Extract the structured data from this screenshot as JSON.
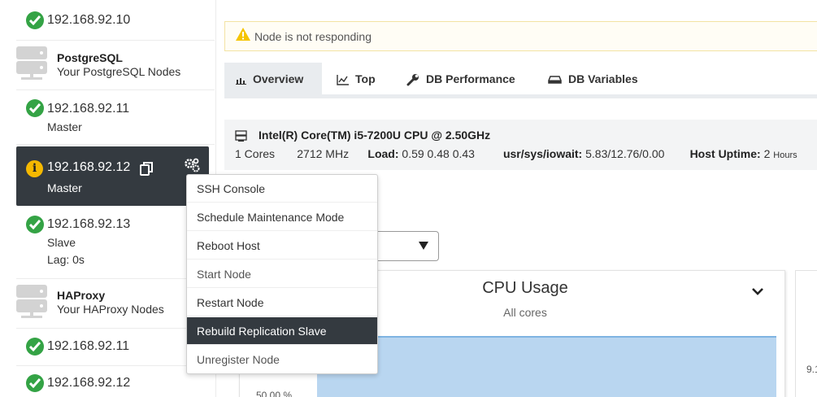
{
  "sidebar": {
    "top_node": {
      "ip": "192.168.92.10"
    },
    "postgres_group": {
      "title": "PostgreSQL",
      "subtitle": "Your PostgreSQL Nodes"
    },
    "node_11": {
      "ip": "192.168.92.11",
      "role": "Master"
    },
    "node_12": {
      "ip": "192.168.92.12",
      "role": "Master"
    },
    "node_13": {
      "ip": "192.168.92.13",
      "role": "Slave",
      "lag": "Lag: 0s"
    },
    "haproxy_group": {
      "title": "HAProxy",
      "subtitle": "Your HAProxy Nodes"
    },
    "ha_node_11": {
      "ip": "192.168.92.11"
    },
    "ha_node_12": {
      "ip": "192.168.92.12"
    }
  },
  "context_menu": {
    "items": [
      "SSH Console",
      "Schedule Maintenance Mode",
      "Reboot Host",
      "Start Node",
      "Restart Node",
      "Rebuild Replication Slave",
      "Unregister Node"
    ],
    "highlighted_index": 5
  },
  "alert": {
    "text": "Node is not responding"
  },
  "tabs": [
    "Overview",
    "Top",
    "DB Performance",
    "DB Variables"
  ],
  "active_tab": "Overview",
  "cpu_info": {
    "name": "Intel(R) Core(TM) i5-7200U CPU @ 2.50GHz",
    "cores": "1 Cores",
    "mhz": "2712 MHz",
    "load_label": "Load:",
    "load_value": "0.59 0.48 0.43",
    "iowait_label": "usr/sys/iowait:",
    "iowait_value": "5.83/12.76/0.00",
    "uptime_label": "Host Uptime:",
    "uptime_value": "2",
    "uptime_unit": "Hours"
  },
  "chart_data": {
    "type": "area",
    "title": "CPU Usage",
    "subtitle": "All cores",
    "ytick_visible": "50.00 %",
    "side_label": "9.1"
  },
  "colors": {
    "ok_green": "#34a345",
    "warn_yellow": "#f5b800",
    "active_dark": "#343a40",
    "area_fill": "#b9d6f0"
  }
}
